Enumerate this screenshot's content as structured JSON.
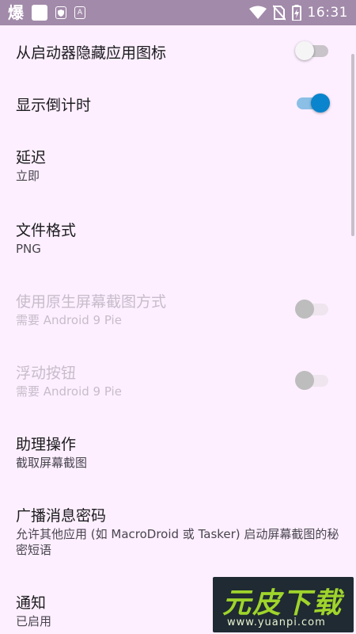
{
  "status_bar": {
    "app_badge": "爆",
    "icon_a": "A",
    "time": "16:31"
  },
  "settings": [
    {
      "title": "从启动器隐藏应用图标",
      "switch": "off"
    },
    {
      "title": "显示倒计时",
      "switch": "on"
    },
    {
      "title": "延迟",
      "summary": "立即"
    },
    {
      "title": "文件格式",
      "summary": "PNG"
    },
    {
      "title": "使用原生屏幕截图方式",
      "summary": "需要 Android 9 Pie",
      "switch": "disabled"
    },
    {
      "title": "浮动按钮",
      "summary": "需要 Android 9 Pie",
      "switch": "disabled"
    },
    {
      "title": "助理操作",
      "summary": "截取屏幕截图"
    },
    {
      "title": "广播消息密码",
      "summary": "允许其他应用 (如 MacroDroid 或 Tasker) 启动屏幕截图的秘密短语"
    },
    {
      "title": "通知",
      "summary": "已启用"
    }
  ],
  "watermark": {
    "brand": "元皮下载",
    "url": "www.yuanpi.com"
  },
  "colors": {
    "background": "#fdefff",
    "status_bar": "#a28aaa",
    "switch_on_thumb": "#0a84cc",
    "switch_on_track": "#8bbfe6"
  }
}
